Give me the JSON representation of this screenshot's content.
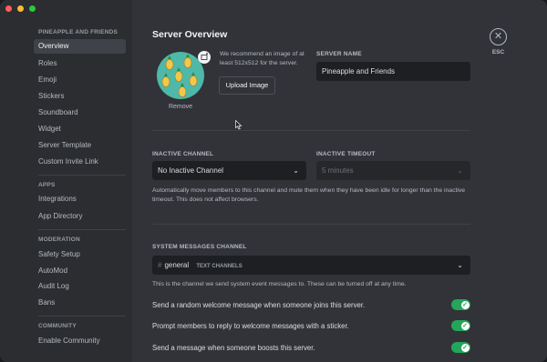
{
  "window": {
    "traffic_colors": [
      "#ff5f57",
      "#febc2e",
      "#28c840"
    ]
  },
  "sidebar": {
    "server_category": "PINEAPPLE AND FRIENDS",
    "server_items": [
      "Overview",
      "Roles",
      "Emoji",
      "Stickers",
      "Soundboard",
      "Widget",
      "Server Template",
      "Custom Invite Link"
    ],
    "apps_category": "APPS",
    "apps_items": [
      "Integrations",
      "App Directory"
    ],
    "moderation_category": "MODERATION",
    "moderation_items": [
      "Safety Setup",
      "AutoMod",
      "Audit Log",
      "Bans"
    ],
    "community_category": "COMMUNITY",
    "community_items": [
      "Enable Community"
    ],
    "active_item": "Overview"
  },
  "main": {
    "title": "Server Overview",
    "esc_label": "ESC",
    "esc_glyph": "✕",
    "icon_hint": "We recommend an image of at least 512x512 for the server.",
    "upload_button": "Upload Image",
    "remove_label": "Remove",
    "server_name_label": "SERVER NAME",
    "server_name_value": "Pineapple and Friends",
    "inactive_channel_label": "INACTIVE CHANNEL",
    "inactive_channel_value": "No Inactive Channel",
    "inactive_timeout_label": "INACTIVE TIMEOUT",
    "inactive_timeout_value": "5 minutes",
    "inactive_help": "Automatically move members to this channel and mute them when they have been idle for longer than the inactive timeout. This does not affect browsers.",
    "system_channel_label": "SYSTEM MESSAGES CHANNEL",
    "system_channel_hash": "#",
    "system_channel_name": "general",
    "system_channel_category": "TEXT CHANNELS",
    "system_help": "This is the channel we send system event messages to. These can be turned off at any time.",
    "toggles": [
      {
        "label": "Send a random welcome message when someone joins this server.",
        "on": true
      },
      {
        "label": "Prompt members to reply to welcome messages with a sticker.",
        "on": true
      },
      {
        "label": "Send a message when someone boosts this server.",
        "on": true
      }
    ],
    "toggle_check": "✓"
  },
  "colors": {
    "accent_green": "#23a55a",
    "sidebar_bg": "#2b2d31",
    "main_bg": "#313338"
  }
}
